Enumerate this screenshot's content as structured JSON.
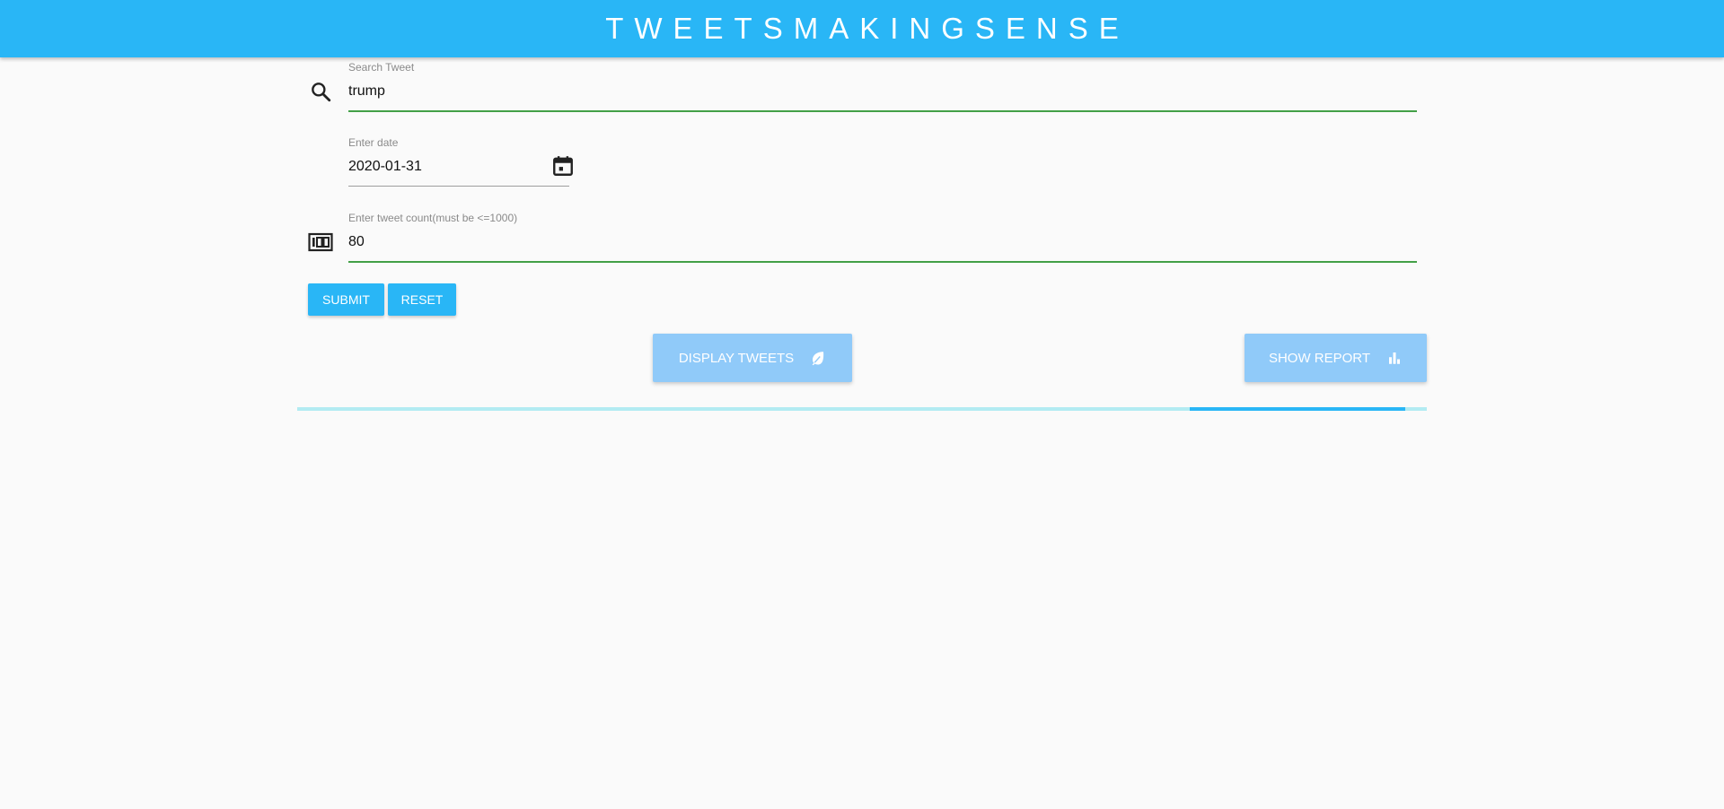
{
  "header": {
    "title": "TWEETSMAKINGSENSE"
  },
  "form": {
    "search": {
      "label": "Search Tweet",
      "value": "trump",
      "icon": "search-icon"
    },
    "date": {
      "label": "Enter date",
      "value": "2020-01-31",
      "icon": "calendar-icon"
    },
    "count": {
      "label": "Enter tweet count(must be <=1000)",
      "value": "80",
      "icon": "counter-icon"
    },
    "submit_label": "SUBMIT",
    "reset_label": "RESET"
  },
  "actions": {
    "display_tweets_label": "DISPLAY TWEETS",
    "display_tweets_icon": "leaf-icon",
    "show_report_label": "SHOW REPORT",
    "show_report_icon": "bar-chart-icon"
  },
  "progress": {
    "state": "indeterminate"
  },
  "colors": {
    "primary": "#29b6f6",
    "disabled_button": "#90caf9",
    "active_underline": "#43a047",
    "progress_track": "#b2ebf2"
  }
}
